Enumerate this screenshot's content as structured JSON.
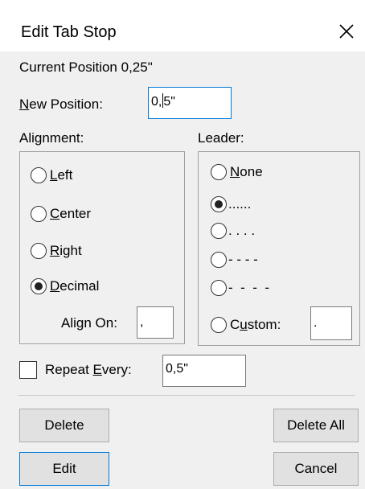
{
  "dialog": {
    "title": "Edit Tab Stop",
    "close_glyph": "×"
  },
  "current_position": {
    "label": "Current Position",
    "value": "0,25\""
  },
  "new_position": {
    "label_mnemonic": "N",
    "label_rest": "ew Position:",
    "value_before_caret": "0,",
    "value_after_caret": "5\""
  },
  "alignment": {
    "heading": "Alignment:",
    "options": [
      {
        "mnemonic": "L",
        "rest": "eft",
        "checked": false
      },
      {
        "mnemonic": "C",
        "rest": "enter",
        "checked": false
      },
      {
        "mnemonic": "R",
        "rest": "ight",
        "checked": false
      },
      {
        "mnemonic": "D",
        "rest": "ecimal",
        "checked": true
      }
    ],
    "align_on": {
      "label": "Align On:",
      "value": ","
    }
  },
  "leader": {
    "heading": "Leader:",
    "options": [
      {
        "label_mnemonic": "N",
        "label_rest": "one",
        "checked": false
      },
      {
        "label": "......",
        "checked": true
      },
      {
        "label": ". . . .",
        "checked": false
      },
      {
        "label": "- - - -",
        "checked": false
      },
      {
        "label": "-  -  -  -",
        "checked": false
      }
    ],
    "custom": {
      "label_pre": "C",
      "label_mnemonic": "u",
      "label_rest": "stom:",
      "checked": false,
      "value": "."
    }
  },
  "repeat": {
    "label_pre": "Repeat ",
    "label_mnemonic": "E",
    "label_rest": "very:",
    "checked": false,
    "value": "0,5\""
  },
  "buttons": {
    "delete": "Delete",
    "delete_all": "Delete All",
    "edit": "Edit",
    "cancel": "Cancel"
  },
  "colors": {
    "accent": "#0078d7",
    "dialog_bg": "#f0f0f0",
    "button_bg": "#e1e1e1"
  }
}
